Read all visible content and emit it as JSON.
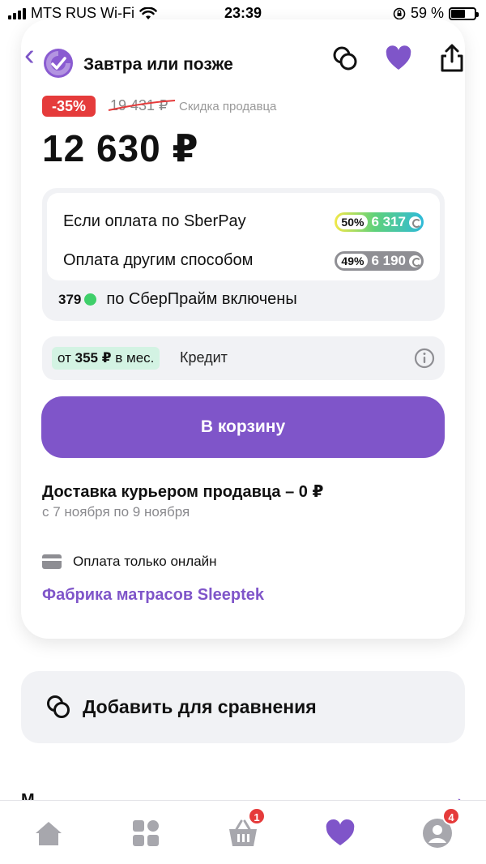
{
  "status_bar": {
    "carrier": "MTS RUS Wi-Fi",
    "time": "23:39",
    "battery": "59 %",
    "battery_level": 0.59
  },
  "header": {
    "merchant_name": "Завтра или позже"
  },
  "product": {
    "discount_badge": "-35%",
    "old_price": "19 431 ₽",
    "discount_note": "Скидка продавца",
    "price": "12 630 ₽"
  },
  "bonuses": {
    "sberpay_label": "Если оплата по SberPay",
    "sberpay_percent": "50%",
    "sberpay_amount": "6 317",
    "other_label": "Оплата другим способом",
    "other_percent": "49%",
    "other_amount": "6 190",
    "prime_amount": "379",
    "prime_text": "по СберПрайм включены"
  },
  "credit": {
    "prefix": "от",
    "amount": "355 ₽",
    "suffix": "в мес.",
    "label": "Кредит"
  },
  "cart_button": "В корзину",
  "delivery": {
    "title": "Доставка курьером продавца – 0 ₽",
    "dates": "с 7 ноября по 9 ноября"
  },
  "payment_note": "Оплата только онлайн",
  "seller_link": "Фабрика матрасов Sleeptek",
  "compare_label": "Добавить для сравнения",
  "peek_text": "М",
  "tabbar": {
    "cart_badge": "1",
    "profile_badge": "4"
  },
  "colors": {
    "accent": "#7f55c9",
    "discount": "#e53b3b",
    "muted": "#8a8a8e"
  }
}
